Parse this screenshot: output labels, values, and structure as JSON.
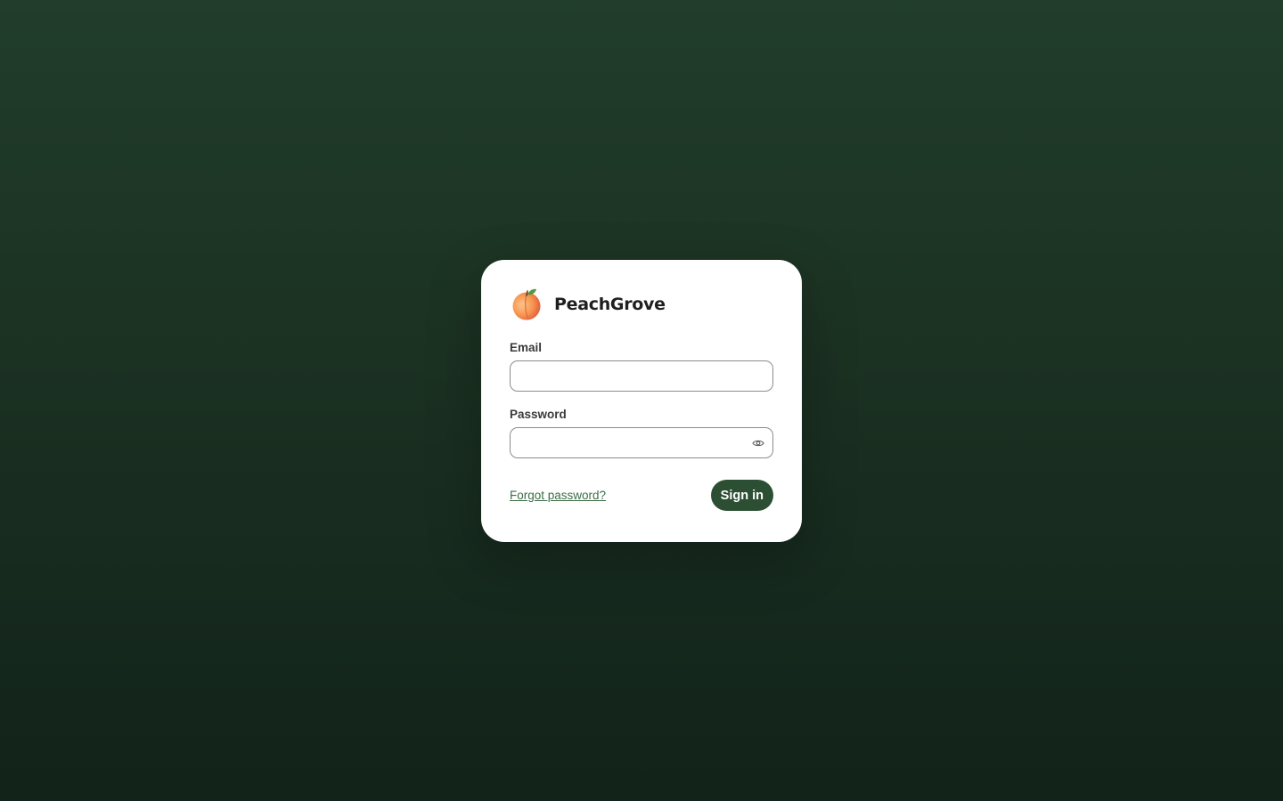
{
  "brand": {
    "name": "PeachGrove",
    "logo_icon": "peach-icon"
  },
  "form": {
    "email": {
      "label": "Email",
      "value": "",
      "placeholder": ""
    },
    "password": {
      "label": "Password",
      "value": "",
      "placeholder": "",
      "toggle_icon": "eye-icon"
    },
    "forgot_link": "Forgot password?",
    "submit_label": "Sign in"
  },
  "colors": {
    "background_top": "#213d2b",
    "background_bottom": "#12231a",
    "card": "#ffffff",
    "accent": "#2c4f33",
    "link": "#3c6e45"
  }
}
